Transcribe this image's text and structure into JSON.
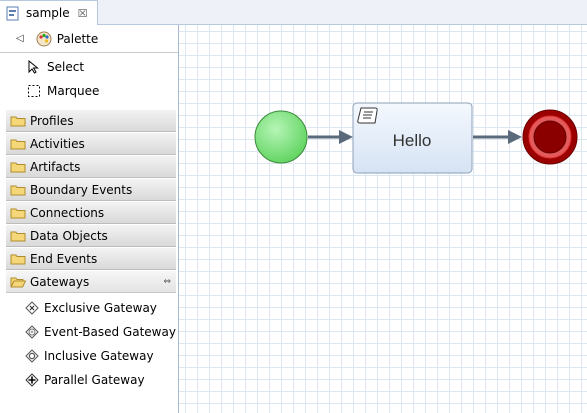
{
  "editor": {
    "tab_title": "sample",
    "tab_close": "☒"
  },
  "palette": {
    "title": "Palette",
    "collapse_glyph": "◁",
    "tools": [
      {
        "label": "Select",
        "icon": "select-arrow-icon"
      },
      {
        "label": "Marquee",
        "icon": "marquee-icon"
      }
    ],
    "drawers": [
      {
        "label": "Profiles"
      },
      {
        "label": "Activities"
      },
      {
        "label": "Artifacts"
      },
      {
        "label": "Boundary Events"
      },
      {
        "label": "Connections"
      },
      {
        "label": "Data Objects"
      },
      {
        "label": "End Events"
      },
      {
        "label": "Gateways"
      }
    ],
    "gateways_pin": "⇔",
    "gateway_items": [
      {
        "label": "Exclusive Gateway",
        "icon": "exclusive-gateway-icon"
      },
      {
        "label": "Event-Based Gateway",
        "icon": "event-based-gateway-icon"
      },
      {
        "label": "Inclusive Gateway",
        "icon": "inclusive-gateway-icon"
      },
      {
        "label": "Parallel Gateway",
        "icon": "parallel-gateway-icon"
      }
    ]
  },
  "diagram": {
    "task_label": "Hello",
    "colors": {
      "start_fill": "#8ee88e",
      "task_fill": "#e6eef9",
      "end_fill": "#9b0000",
      "arrow": "#5a6a7a"
    }
  }
}
